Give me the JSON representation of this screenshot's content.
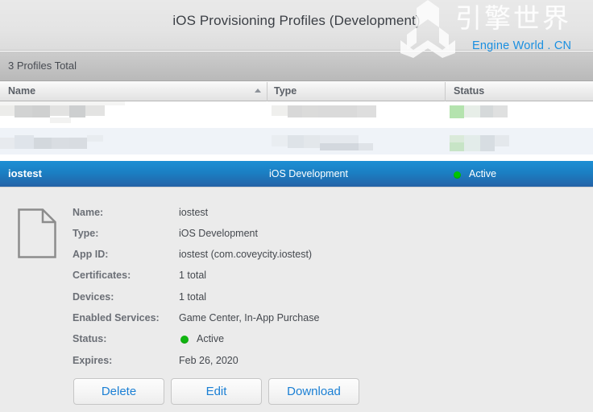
{
  "window": {
    "title": "iOS Provisioning Profiles (Development)"
  },
  "watermark": {
    "han_text": "引擎世界",
    "en_text": "Engine World . CN",
    "logo_icon": "engine-world-logo-icon",
    "en_color": "#1a8fe0"
  },
  "toolbar": {
    "count_label": "3 Profiles Total"
  },
  "table": {
    "columns": [
      {
        "key": "name",
        "label": "Name",
        "sorted": true,
        "sort_dir": "asc"
      },
      {
        "key": "type",
        "label": "Type"
      },
      {
        "key": "status",
        "label": "Status"
      }
    ],
    "sort_icon": "sort-ascending-arrow-icon",
    "rows": [
      {
        "name": "",
        "type": "",
        "status": "",
        "redacted": true,
        "selected": false
      },
      {
        "name": "",
        "type": "",
        "status": "",
        "redacted": true,
        "selected": false
      },
      {
        "name": "iostest",
        "type": "iOS Development",
        "status": "Active",
        "redacted": false,
        "selected": true
      }
    ]
  },
  "detail": {
    "icon": "document-file-icon",
    "fields": [
      {
        "label": "Name:",
        "value": "iostest"
      },
      {
        "label": "Type:",
        "value": "iOS Development"
      },
      {
        "label": "App ID:",
        "value": "iostest (com.coveycity.iostest)"
      },
      {
        "label": "Certificates:",
        "value": "1 total"
      },
      {
        "label": "Devices:",
        "value": "1 total"
      },
      {
        "label": "Enabled Services:",
        "value": "Game Center, In-App Purchase"
      },
      {
        "label": "Status:",
        "value": "Active"
      },
      {
        "label": "Expires:",
        "value": "Feb 26, 2020"
      }
    ],
    "status_label": "Status:",
    "status_value": "Active",
    "status_dot_color": "#10b510",
    "expires_label": "Expires:",
    "expires_value": "Feb 26, 2020"
  },
  "actions": {
    "delete_label": "Delete",
    "edit_label": "Edit",
    "download_label": "Download",
    "link_color": "#1a7fd4"
  },
  "colors": {
    "selected_row": "#1b7ec2",
    "panel_bg": "#ebebeb",
    "header_bg": "#e4e4e4",
    "countbar_bg": "#c3c3c3"
  }
}
